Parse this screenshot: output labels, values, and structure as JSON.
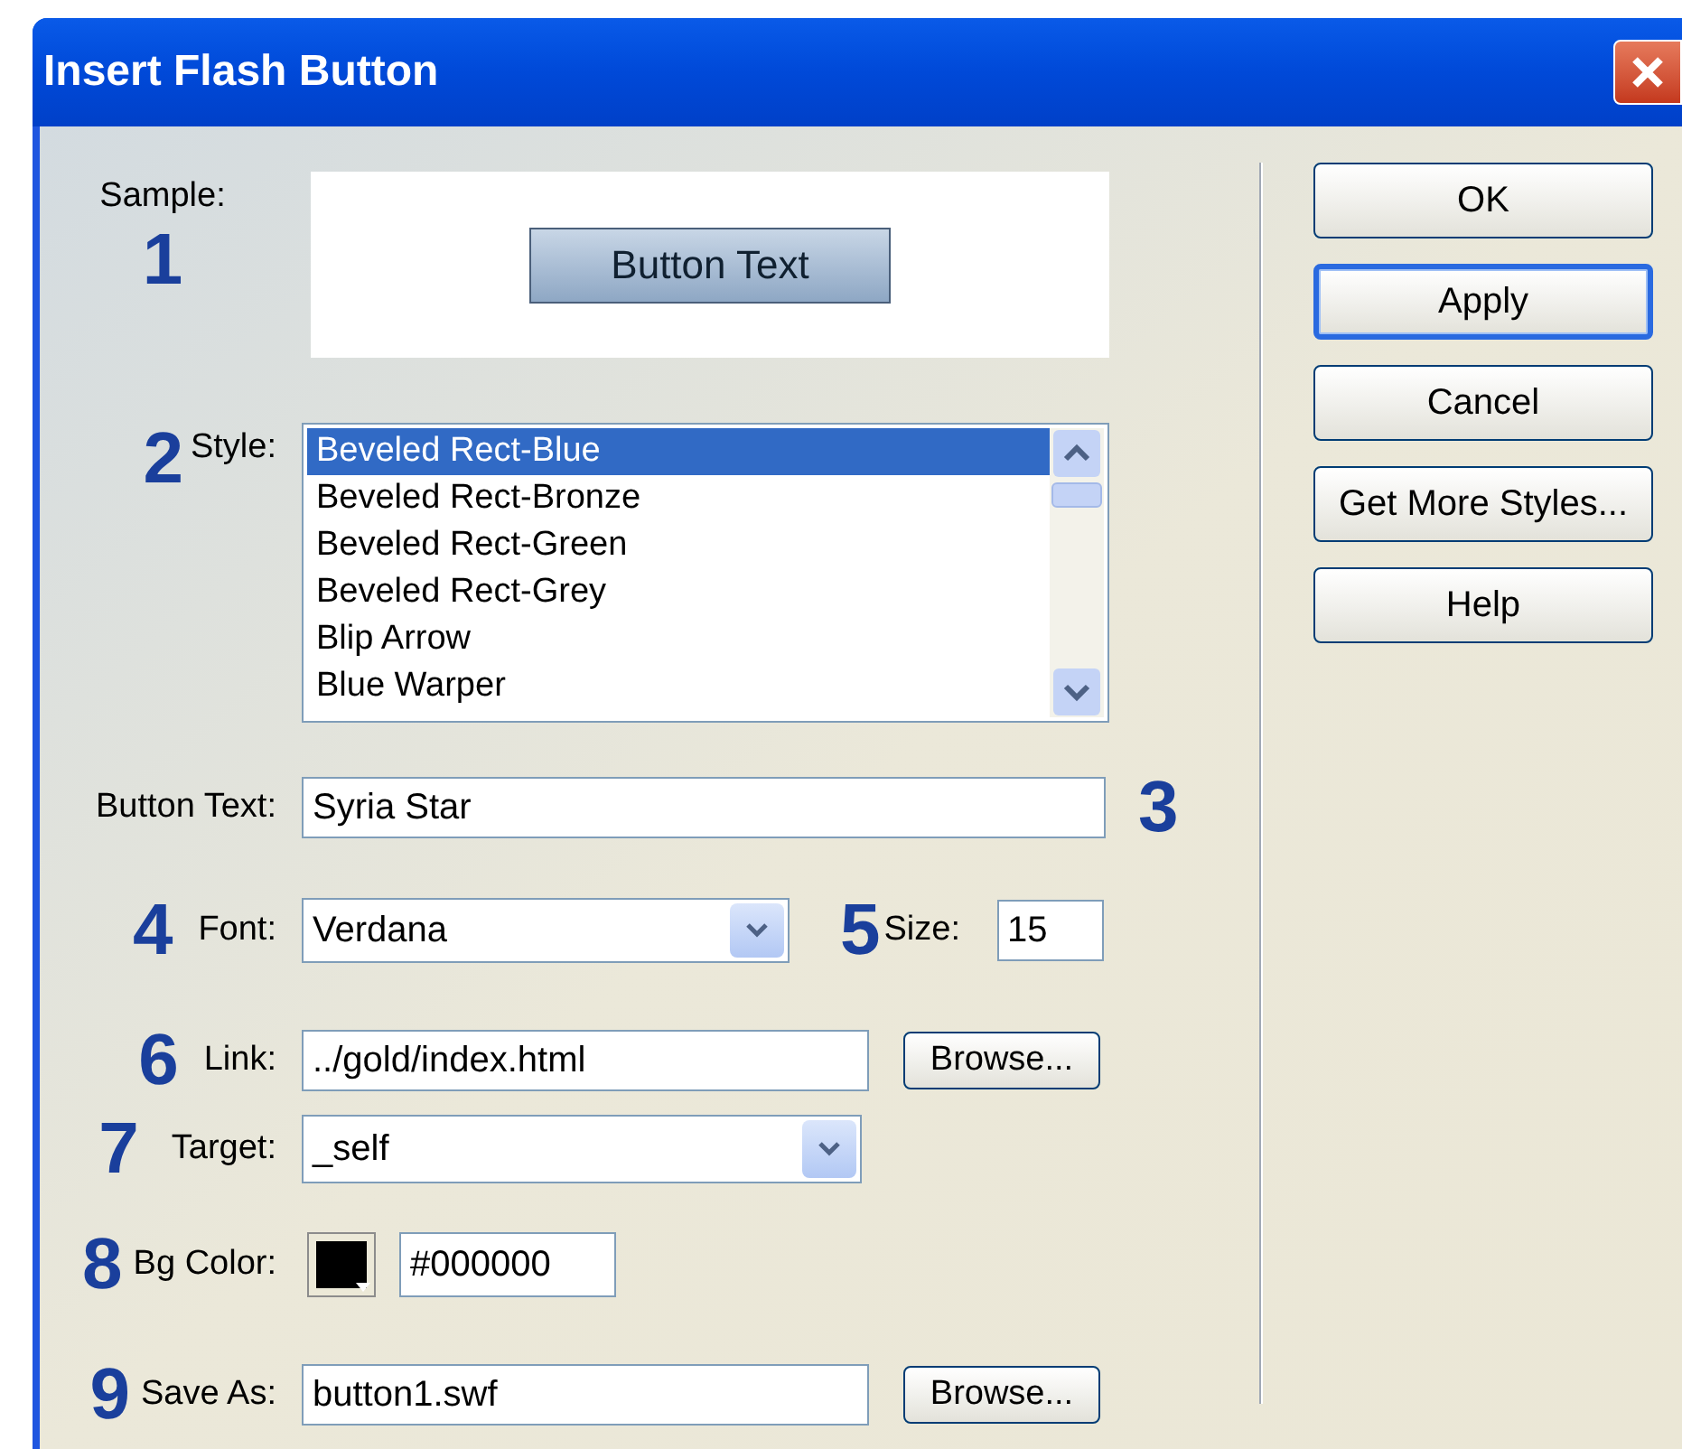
{
  "window": {
    "title": "Insert Flash Button"
  },
  "sample": {
    "label": "Sample:",
    "marker": "1",
    "preview_text": "Button Text"
  },
  "style": {
    "label": "Style:",
    "marker": "2",
    "items": [
      {
        "label": "Beveled Rect-Blue",
        "selected": true
      },
      {
        "label": "Beveled Rect-Bronze",
        "selected": false
      },
      {
        "label": "Beveled Rect-Green",
        "selected": false
      },
      {
        "label": "Beveled Rect-Grey",
        "selected": false
      },
      {
        "label": "Blip Arrow",
        "selected": false
      },
      {
        "label": "Blue Warper",
        "selected": false
      }
    ]
  },
  "button_text": {
    "label": "Button Text:",
    "marker": "3",
    "value": "Syria Star"
  },
  "font": {
    "label": "Font:",
    "marker": "4",
    "value": "Verdana"
  },
  "size": {
    "label": "Size:",
    "marker": "5",
    "value": "15"
  },
  "link": {
    "label": "Link:",
    "marker": "6",
    "value": "../gold/index.html",
    "browse": "Browse..."
  },
  "target": {
    "label": "Target:",
    "marker": "7",
    "value": "_self"
  },
  "bg_color": {
    "label": "Bg Color:",
    "marker": "8",
    "color": "#000000",
    "value": "#000000"
  },
  "save_as": {
    "label": "Save As:",
    "marker": "9",
    "value": "button1.swf",
    "browse": "Browse..."
  },
  "buttons": [
    {
      "label": "OK",
      "focused": false
    },
    {
      "label": "Apply",
      "focused": true
    },
    {
      "label": "Cancel",
      "focused": false
    },
    {
      "label": "Get More Styles...",
      "focused": false
    },
    {
      "label": "Help",
      "focused": false
    }
  ]
}
